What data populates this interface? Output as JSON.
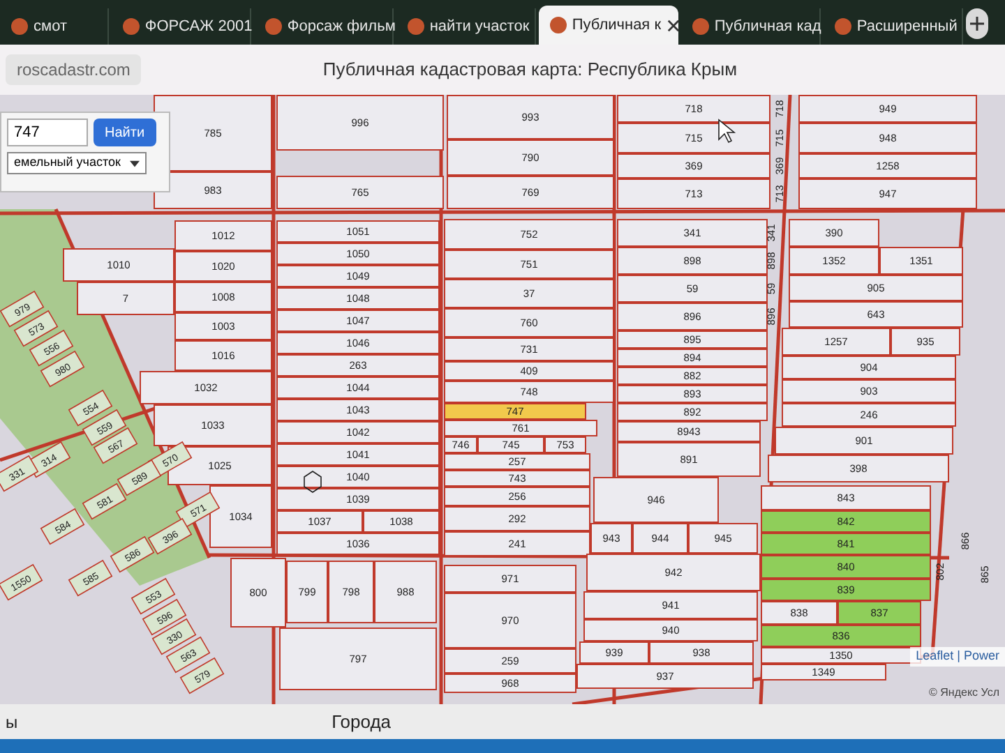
{
  "tabs": [
    {
      "label": "смот",
      "selected": false
    },
    {
      "label": "ФОРСАЖ 2001",
      "selected": false
    },
    {
      "label": "Форсаж фильм",
      "selected": false
    },
    {
      "label": "найти участок",
      "selected": false
    },
    {
      "label": "Публичная к",
      "selected": true
    },
    {
      "label": "Публичная кад",
      "selected": false
    },
    {
      "label": "Расширенный",
      "selected": false
    }
  ],
  "address_bar": {
    "value": "roscadastr.com"
  },
  "page_title": "Публичная кадастровая карта: Республика Крым",
  "search_panel": {
    "value": "747",
    "button": "Найти",
    "select": "емельный участок"
  },
  "parcels": [
    {
      "label": "785",
      "selected": false
    },
    {
      "label": "983",
      "selected": false
    },
    {
      "label": "996",
      "selected": false
    },
    {
      "label": "765",
      "selected": false
    },
    {
      "label": "993",
      "selected": false
    },
    {
      "label": "790",
      "selected": false
    },
    {
      "label": "769",
      "selected": false
    },
    {
      "label": "718",
      "selected": false
    },
    {
      "label": "715",
      "selected": false
    },
    {
      "label": "369",
      "selected": false
    },
    {
      "label": "713",
      "selected": false
    },
    {
      "label": "949",
      "selected": false
    },
    {
      "label": "948",
      "selected": false
    },
    {
      "label": "1258",
      "selected": false
    },
    {
      "label": "947",
      "selected": false
    },
    {
      "label": "1010",
      "selected": false
    },
    {
      "label": "7",
      "selected": false
    },
    {
      "label": "1012",
      "selected": false
    },
    {
      "label": "1020",
      "selected": false
    },
    {
      "label": "1008",
      "selected": false
    },
    {
      "label": "1003",
      "selected": false
    },
    {
      "label": "1016",
      "selected": false
    },
    {
      "label": "1032",
      "selected": false
    },
    {
      "label": "1033",
      "selected": false
    },
    {
      "label": "1025",
      "selected": false
    },
    {
      "label": "1034",
      "selected": false
    },
    {
      "label": "1051",
      "selected": false
    },
    {
      "label": "1050",
      "selected": false
    },
    {
      "label": "1049",
      "selected": false
    },
    {
      "label": "1048",
      "selected": false
    },
    {
      "label": "1047",
      "selected": false
    },
    {
      "label": "1046",
      "selected": false
    },
    {
      "label": "263",
      "selected": false
    },
    {
      "label": "1044",
      "selected": false
    },
    {
      "label": "1043",
      "selected": false
    },
    {
      "label": "1042",
      "selected": false
    },
    {
      "label": "1041",
      "selected": false
    },
    {
      "label": "1040",
      "selected": false
    },
    {
      "label": "1039",
      "selected": false
    },
    {
      "label": "1037",
      "selected": false
    },
    {
      "label": "1038",
      "selected": false
    },
    {
      "label": "1036",
      "selected": false
    },
    {
      "label": "752",
      "selected": false
    },
    {
      "label": "751",
      "selected": false
    },
    {
      "label": "37",
      "selected": false
    },
    {
      "label": "760",
      "selected": false
    },
    {
      "label": "731",
      "selected": false
    },
    {
      "label": "409",
      "selected": false
    },
    {
      "label": "748",
      "selected": false
    },
    {
      "label": "747",
      "selected": true
    },
    {
      "label": "761",
      "selected": false
    },
    {
      "label": "746",
      "selected": false
    },
    {
      "label": "745",
      "selected": false
    },
    {
      "label": "753",
      "selected": false
    },
    {
      "label": "257",
      "selected": false
    },
    {
      "label": "743",
      "selected": false
    },
    {
      "label": "256",
      "selected": false
    },
    {
      "label": "292",
      "selected": false
    },
    {
      "label": "241",
      "selected": false
    },
    {
      "label": "341",
      "selected": false
    },
    {
      "label": "898",
      "selected": false
    },
    {
      "label": "59",
      "selected": false
    },
    {
      "label": "896",
      "selected": false
    },
    {
      "label": "895",
      "selected": false
    },
    {
      "label": "894",
      "selected": false
    },
    {
      "label": "882",
      "selected": false
    },
    {
      "label": "893",
      "selected": false
    },
    {
      "label": "892",
      "selected": false
    },
    {
      "label": "8943",
      "selected": false
    },
    {
      "label": "891",
      "selected": false
    },
    {
      "label": "390",
      "selected": false
    },
    {
      "label": "1352",
      "selected": false
    },
    {
      "label": "1351",
      "selected": false
    },
    {
      "label": "905",
      "selected": false
    },
    {
      "label": "643",
      "selected": false
    },
    {
      "label": "1257",
      "selected": false
    },
    {
      "label": "935",
      "selected": false
    },
    {
      "label": "904",
      "selected": false
    },
    {
      "label": "903",
      "selected": false
    },
    {
      "label": "246",
      "selected": false
    },
    {
      "label": "901",
      "selected": false
    },
    {
      "label": "398",
      "selected": false
    },
    {
      "label": "946",
      "selected": false
    },
    {
      "label": "943",
      "selected": false
    },
    {
      "label": "944",
      "selected": false
    },
    {
      "label": "945",
      "selected": false
    },
    {
      "label": "942",
      "selected": false
    },
    {
      "label": "941",
      "selected": false
    },
    {
      "label": "940",
      "selected": false
    },
    {
      "label": "939",
      "selected": false
    },
    {
      "label": "938",
      "selected": false
    },
    {
      "label": "937",
      "selected": false
    },
    {
      "label": "843",
      "selected": false
    },
    {
      "label": "842",
      "selected": false,
      "color": "#8fce5a"
    },
    {
      "label": "841",
      "selected": false,
      "color": "#8fce5a"
    },
    {
      "label": "840",
      "selected": false,
      "color": "#8fce5a"
    },
    {
      "label": "839",
      "selected": false,
      "color": "#8fce5a"
    },
    {
      "label": "838",
      "selected": false
    },
    {
      "label": "837",
      "selected": false,
      "color": "#8fce5a"
    },
    {
      "label": "836",
      "selected": false,
      "color": "#8fce5a"
    },
    {
      "label": "1350",
      "selected": false
    },
    {
      "label": "1349",
      "selected": false
    },
    {
      "label": "971",
      "selected": false
    },
    {
      "label": "970",
      "selected": false
    },
    {
      "label": "259",
      "selected": false
    },
    {
      "label": "968",
      "selected": false
    },
    {
      "label": "800",
      "selected": false
    },
    {
      "label": "799",
      "selected": false
    },
    {
      "label": "798",
      "selected": false
    },
    {
      "label": "988",
      "selected": false
    },
    {
      "label": "797",
      "selected": false
    }
  ],
  "side_labels": [
    "718",
    "715",
    "369",
    "713",
    "341",
    "898",
    "59",
    "896",
    "802",
    "866",
    "865"
  ],
  "slanted_parcels": [
    "979",
    "573",
    "556",
    "980",
    "554",
    "559",
    "567",
    "314",
    "331",
    "570",
    "589",
    "581",
    "584",
    "571",
    "396",
    "586",
    "585",
    "1550",
    "553",
    "596",
    "330",
    "563",
    "579"
  ],
  "attribution": "Leaflet | Power",
  "copyright": "© Яндекс Усл",
  "bottom_left": "ы",
  "bottom_center": "Города"
}
